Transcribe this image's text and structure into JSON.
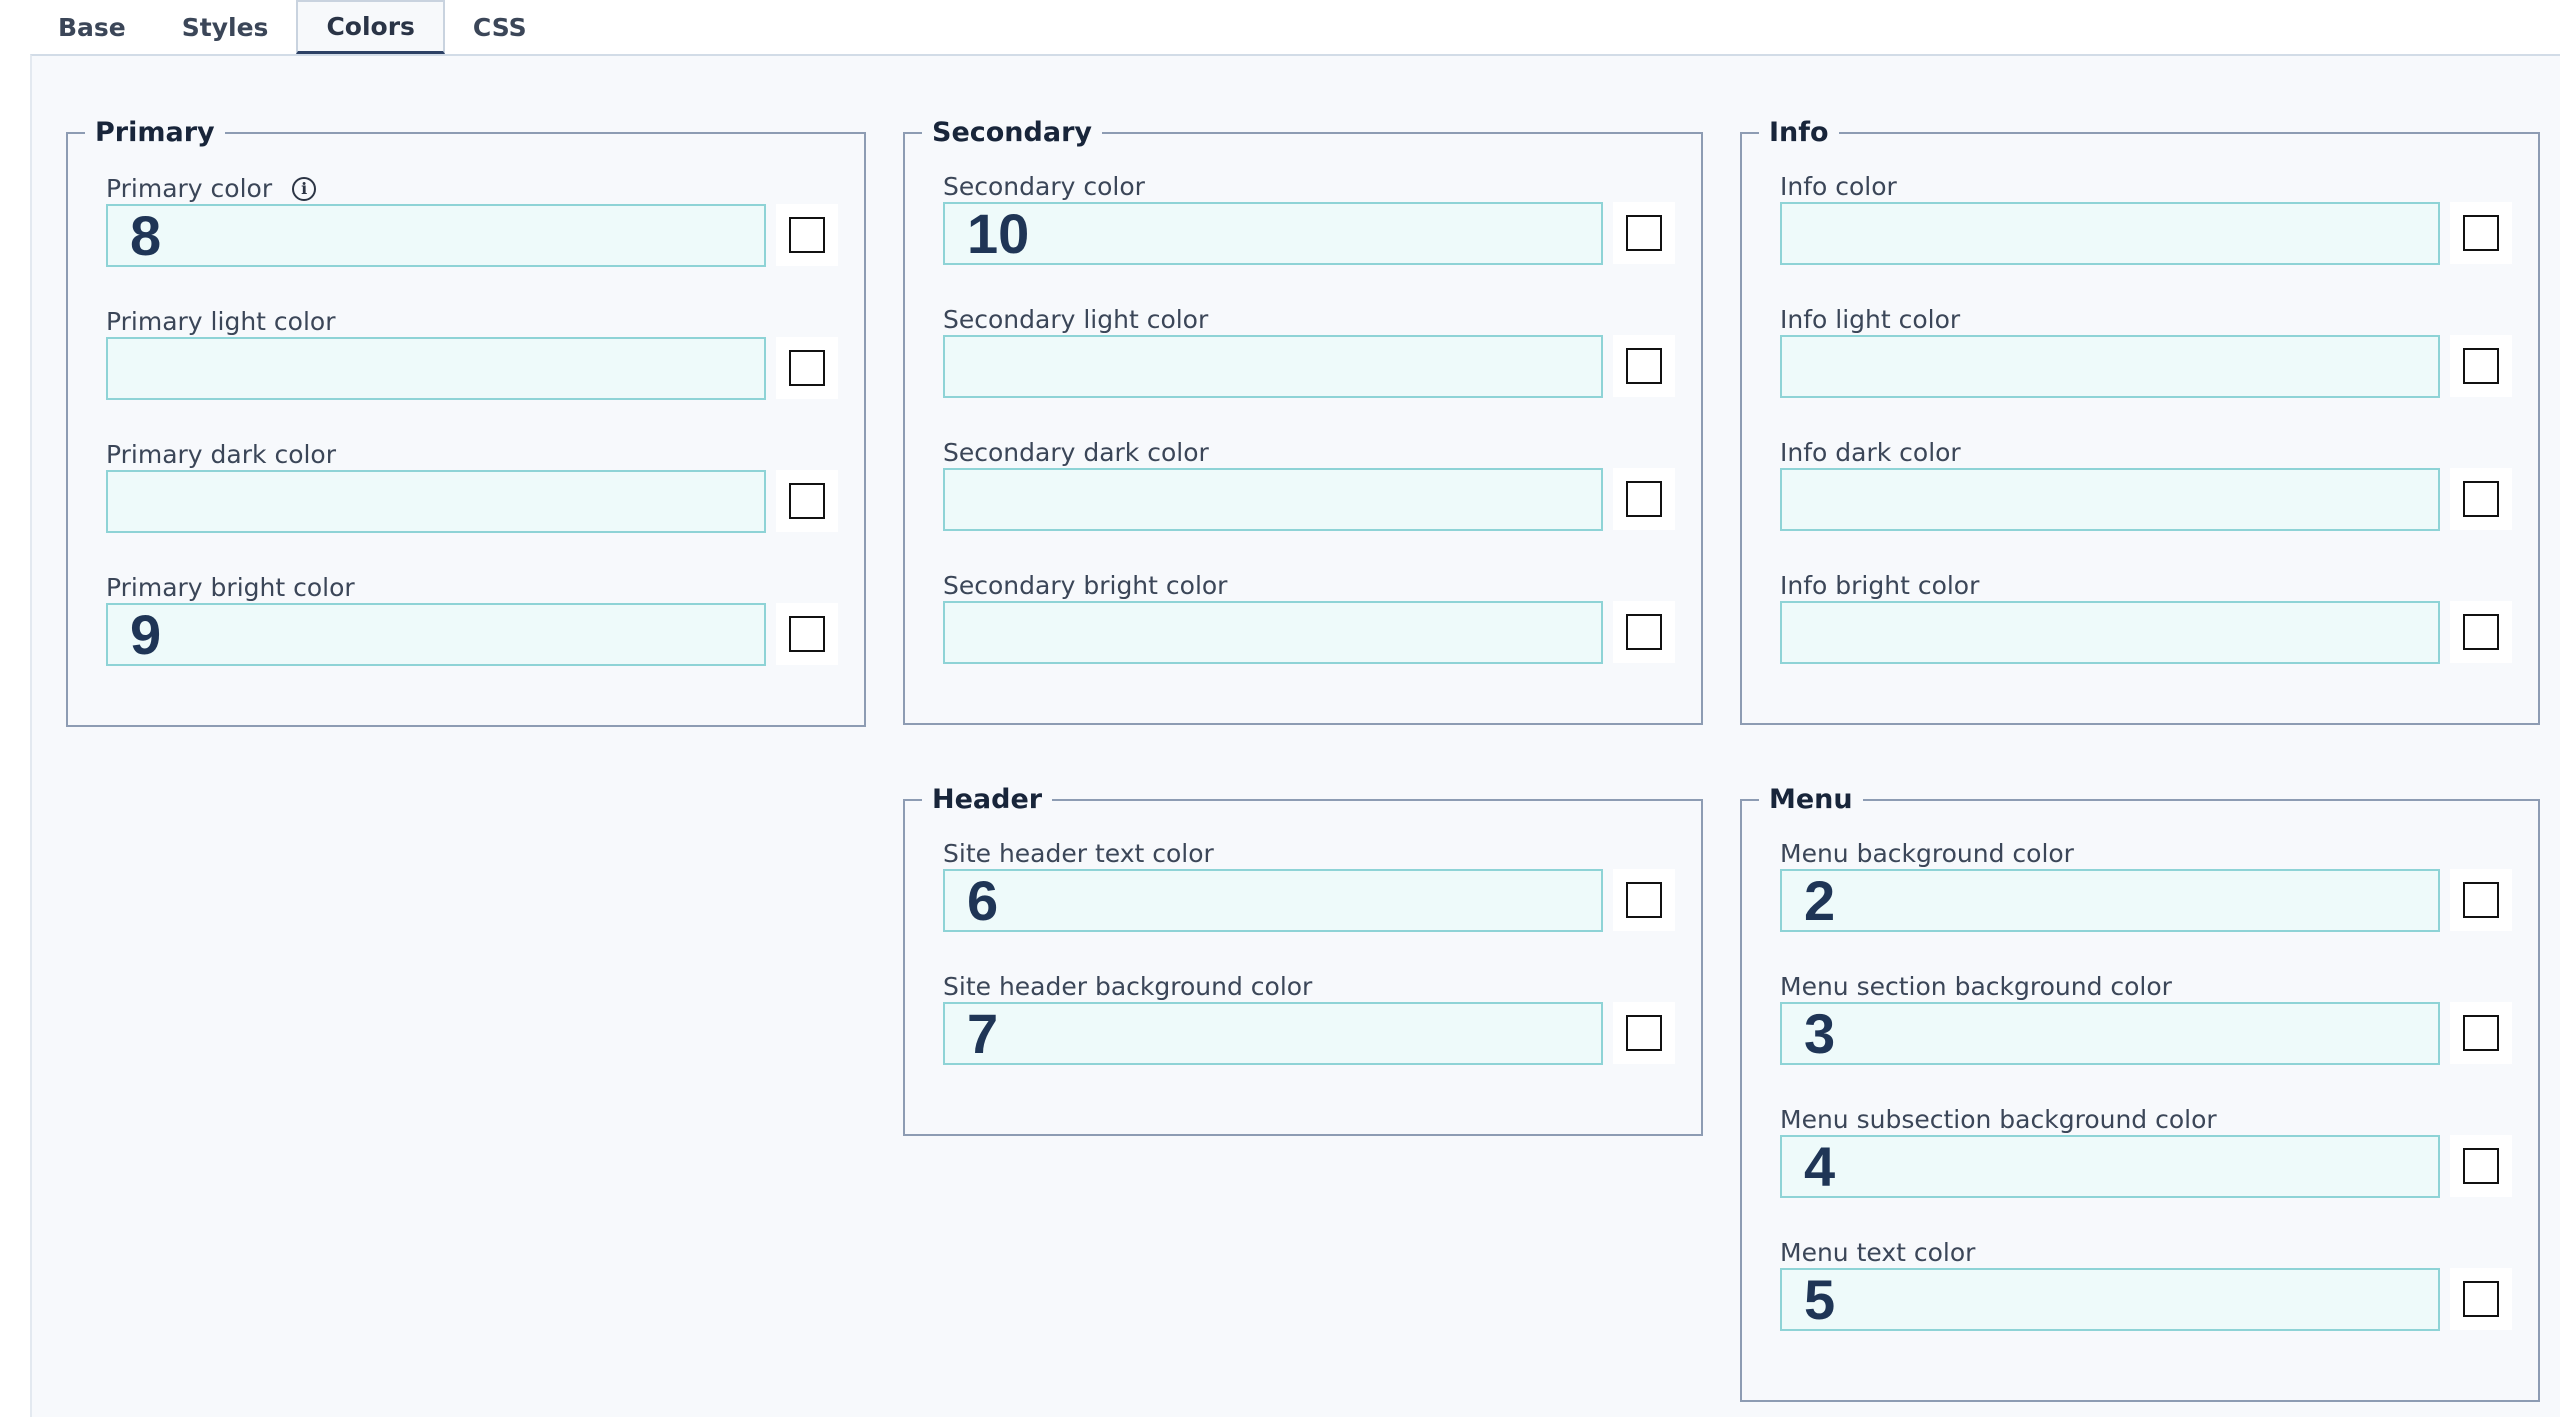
{
  "tabs": [
    {
      "label": "Base",
      "active": false
    },
    {
      "label": "Styles",
      "active": false
    },
    {
      "label": "Colors",
      "active": true
    },
    {
      "label": "CSS",
      "active": false
    }
  ],
  "groups": {
    "primary": {
      "title": "Primary",
      "fields": [
        {
          "label": "Primary color",
          "value": "8",
          "info": true
        },
        {
          "label": "Primary light color",
          "value": ""
        },
        {
          "label": "Primary dark color",
          "value": ""
        },
        {
          "label": "Primary bright color",
          "value": "9"
        }
      ]
    },
    "secondary": {
      "title": "Secondary",
      "fields": [
        {
          "label": "Secondary color",
          "value": "10"
        },
        {
          "label": "Secondary light color",
          "value": ""
        },
        {
          "label": "Secondary dark color",
          "value": ""
        },
        {
          "label": "Secondary bright color",
          "value": ""
        }
      ]
    },
    "info": {
      "title": "Info",
      "fields": [
        {
          "label": "Info color",
          "value": ""
        },
        {
          "label": "Info light color",
          "value": ""
        },
        {
          "label": "Info dark color",
          "value": ""
        },
        {
          "label": "Info bright color",
          "value": ""
        }
      ]
    },
    "header": {
      "title": "Header",
      "fields": [
        {
          "label": "Site header text color",
          "value": "6"
        },
        {
          "label": "Site header background color",
          "value": "7"
        }
      ]
    },
    "menu": {
      "title": "Menu",
      "fields": [
        {
          "label": "Menu background color",
          "value": "2"
        },
        {
          "label": "Menu section background color",
          "value": "3"
        },
        {
          "label": "Menu subsection background color",
          "value": "4"
        },
        {
          "label": "Menu text color",
          "value": "5"
        }
      ]
    }
  },
  "colors": {
    "input_border": "#8ed3d6",
    "input_bg": "#eefafa",
    "fieldset_border": "#8d9cb3",
    "accent": "#2d4165"
  },
  "icons": {
    "info": "info-circle-icon"
  }
}
